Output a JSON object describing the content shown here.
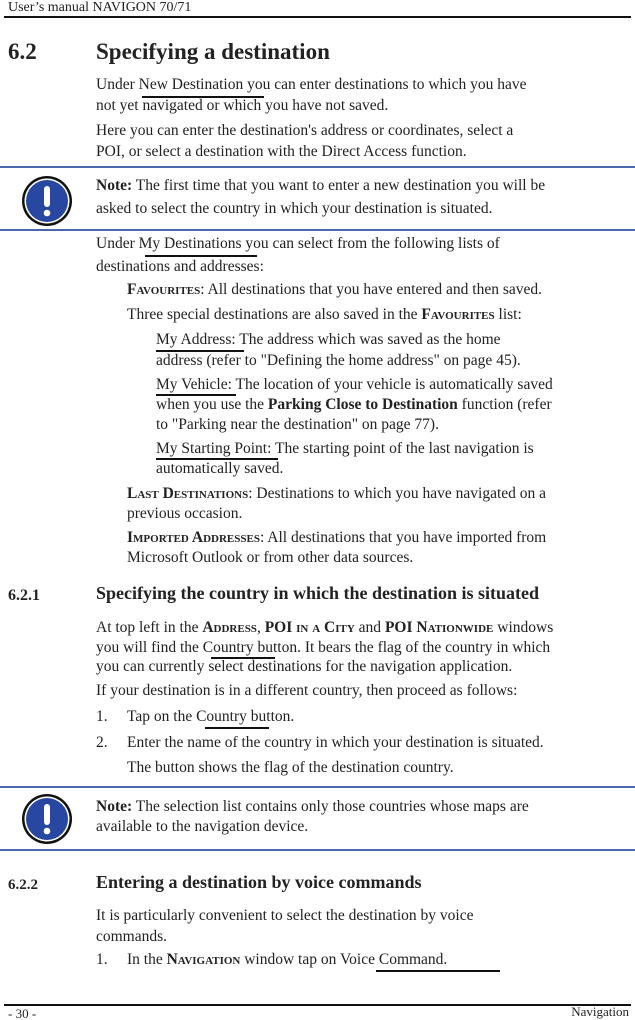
{
  "header": {
    "title": "User’s manual NAVIGON 70/71"
  },
  "section_6_2": {
    "number": "6.2",
    "title": "Specifying a destination",
    "p1_pre": "Under ",
    "p1_link": "New Destination",
    "p1_post": " you can enter destinations to which you have",
    "p1_line2": "not yet navigated or which you have not saved.",
    "p2_line1": "Here you can enter the destination's address or coordinates, select a",
    "p2_line2": "POI, or select a destination with the Direct Access function."
  },
  "note1": {
    "icon": "exclamation-icon",
    "label": "Note:",
    "line1": " The first time that you want to enter a new destination you will be",
    "line2": "asked to select the country in which your destination is situated."
  },
  "my_destinations": {
    "intro_pre": "Under ",
    "intro_link": "My Destinations",
    "intro_post": " you can select from the following lists of",
    "intro_line2": "destinations and addresses:",
    "favourites_label": "Favourites",
    "favourites_text": ": All destinations that you have entered and then saved.",
    "special_pre": "Three special destinations are also saved in the ",
    "special_label": "Favourites",
    "special_post": " list:",
    "my_address_link": "My Address:",
    "my_address_text": " The address which was saved as the home",
    "my_address_line2": "address (refer to \"Defining the home address\" on page 45).",
    "my_vehicle_link": "My Vehicle",
    "my_vehicle_text": ": The location of your vehicle is automatically saved",
    "my_vehicle_line2_pre": "when you use the ",
    "my_vehicle_line2_bold": "Parking Close to Destination",
    "my_vehicle_line2_post": " function (refer",
    "my_vehicle_line3": "to \"Parking near the destination\" on page 77).",
    "my_start_link": "My Starting Point:",
    "my_start_text": " The starting point of the last navigation is",
    "my_start_line2": "automatically saved.",
    "last_label": "Last Destinations",
    "last_text": ": Destinations to which you have navigated on a",
    "last_line2": "previous occasion.",
    "imported_label": "Imported Addresses",
    "imported_text": ": All destinations that you have imported from",
    "imported_line2": "Microsoft Outlook or from other data sources."
  },
  "section_6_2_1": {
    "number": "6.2.1",
    "title": "Specifying the country in which the destination is situated",
    "p1_pre": "At top left in the ",
    "p1_w1": "Address",
    "p1_sep1": ", ",
    "p1_w2": "POI in a City",
    "p1_sep2": " and ",
    "p1_w3": "POI Nationwide",
    "p1_post": " windows",
    "p1_line2_pre": "you will find the ",
    "p1_line2_link": "Country",
    "p1_line2_post": " button. It bears the flag of the country in which",
    "p1_line3": "you can currently select destinations for the navigation application.",
    "p2": "If your destination is in a different country, then proceed as follows:",
    "steps": [
      {
        "num": "1.",
        "pre": "Tap on the ",
        "link": "Country",
        "post": " button."
      },
      {
        "num": "2.",
        "text": "Enter the name of the country in which your destination is situated."
      }
    ],
    "result": "The button shows the flag of the destination country."
  },
  "note2": {
    "icon": "exclamation-icon",
    "label": "Note:",
    "line1": " The selection list contains only those countries whose maps are",
    "line2": "available to the navigation device."
  },
  "section_6_2_2": {
    "number": "6.2.2",
    "title": "Entering a destination by voice commands",
    "p1_line1": "It is particularly convenient to select the destination by voice",
    "p1_line2": "commands.",
    "step1_num": "1.",
    "step1_pre": "In the ",
    "step1_label": "Navigation",
    "step1_mid": " window tap on ",
    "step1_link": "Voice Command."
  },
  "footer": {
    "page": "- 30 -",
    "section": "Navigation"
  },
  "colors": {
    "note_rule": "#4a66ad",
    "note_icon_fill": "#2847a0",
    "rule": "#111111"
  }
}
